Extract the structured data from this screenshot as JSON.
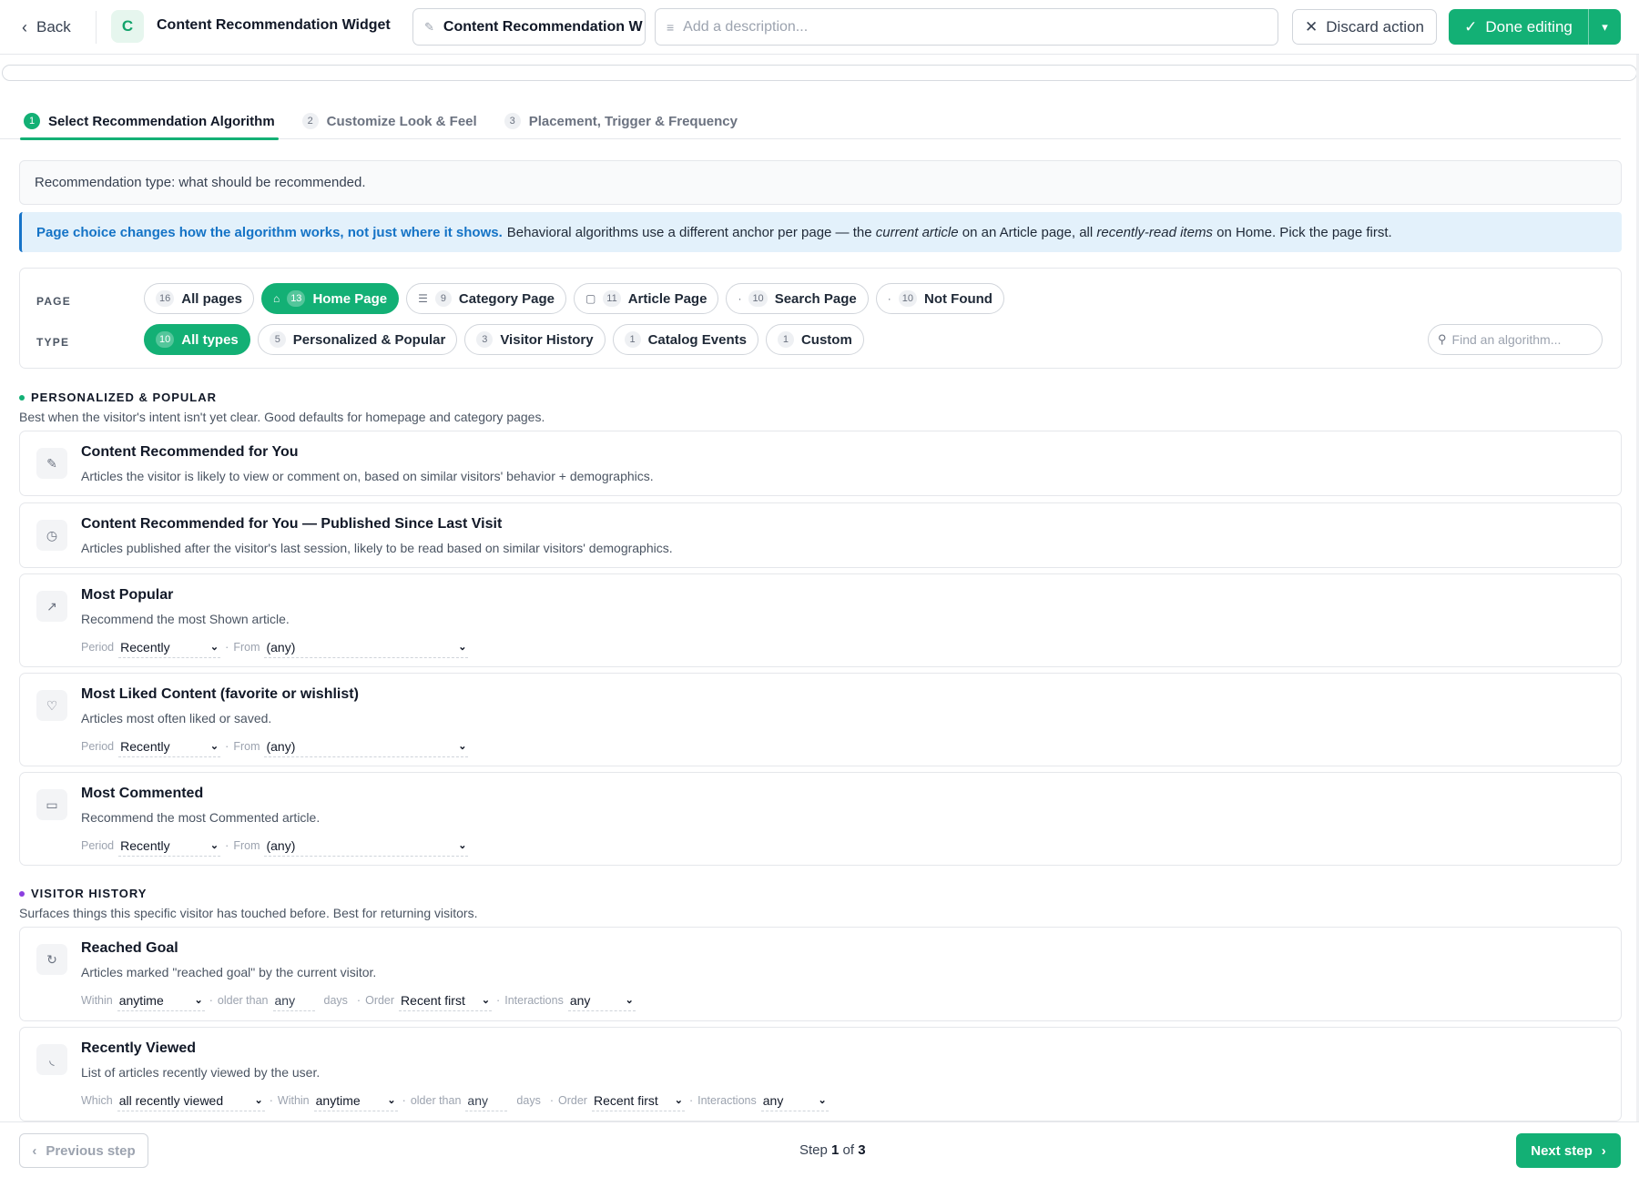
{
  "header": {
    "back_label": "Back",
    "avatar_letter": "C",
    "widget_title": "Content Recommendation Widget",
    "name_value": "Content Recommendation W",
    "description_placeholder": "Add a description...",
    "discard_label": "Discard action",
    "done_label": "Done editing"
  },
  "tabs": [
    {
      "num": "1",
      "label": "Select Recommendation Algorithm",
      "active": true
    },
    {
      "num": "2",
      "label": "Customize Look & Feel",
      "active": false
    },
    {
      "num": "3",
      "label": "Placement, Trigger & Frequency",
      "active": false
    }
  ],
  "rec_type_note": "Recommendation type: what should be recommended.",
  "banner": {
    "strong": "Page choice changes how the algorithm works, not just where it shows.",
    "p1": "Behavioral algorithms use a different anchor per page — the",
    "em1": "current article",
    "p2": "on an Article page, all",
    "em2": "recently-read items",
    "p3": "on Home. Pick the page first."
  },
  "filters": {
    "page_label": "PAGE",
    "type_label": "TYPE",
    "pages": [
      {
        "count": "16",
        "label": "All pages",
        "icon": "",
        "active": false
      },
      {
        "count": "13",
        "label": "Home Page",
        "icon": "⌂",
        "active": true
      },
      {
        "count": "9",
        "label": "Category Page",
        "icon": "☰",
        "active": false
      },
      {
        "count": "11",
        "label": "Article Page",
        "icon": "▢",
        "active": false
      },
      {
        "count": "10",
        "label": "Search Page",
        "icon": "·",
        "active": false
      },
      {
        "count": "10",
        "label": "Not Found",
        "icon": "·",
        "active": false
      }
    ],
    "types": [
      {
        "count": "10",
        "label": "All types",
        "active": true
      },
      {
        "count": "5",
        "label": "Personalized & Popular",
        "active": false
      },
      {
        "count": "3",
        "label": "Visitor History",
        "active": false
      },
      {
        "count": "1",
        "label": "Catalog Events",
        "active": false
      },
      {
        "count": "1",
        "label": "Custom",
        "active": false
      }
    ],
    "search_placeholder": "Find an algorithm..."
  },
  "sections": {
    "personalized": {
      "title": "PERSONALIZED & POPULAR",
      "desc": "Best when the visitor's intent isn't yet clear. Good defaults for homepage and category pages.",
      "dot_color": "#13b075",
      "cards": [
        {
          "title": "Content Recommended for You",
          "desc": "Articles the visitor is likely to view or comment on, based on similar visitors' behavior + demographics.",
          "icon": "pen-icon"
        },
        {
          "title": "Content Recommended for You — Published Since Last Visit",
          "desc": "Articles published after the visitor's last session, likely to be read based on similar visitors' demographics.",
          "icon": "clock-icon"
        },
        {
          "title": "Most Popular",
          "desc": "Recommend the most Shown article.",
          "icon": "trend-icon"
        },
        {
          "title": "Most Liked Content (favorite or wishlist)",
          "desc": "Articles most often liked or saved.",
          "icon": "heart-icon"
        },
        {
          "title": "Most Commented",
          "desc": "Recommend the most Commented article.",
          "icon": "comment-icon"
        }
      ]
    },
    "history": {
      "title": "VISITOR HISTORY",
      "desc": "Surfaces things this specific visitor has touched before. Best for returning visitors.",
      "dot_color": "#8b3fe0",
      "cards": [
        {
          "title": "Reached Goal",
          "desc": "Articles marked \"reached goal\" by the current visitor.",
          "icon": "refresh-icon"
        },
        {
          "title": "Recently Viewed",
          "desc": "List of articles recently viewed by the user.",
          "icon": "recent-icon"
        }
      ]
    }
  },
  "options": {
    "period_label": "Period",
    "from_label": "From",
    "within_label": "Within",
    "older_than_label": "older than",
    "days_label": "days",
    "order_label": "Order",
    "interactions_label": "Interactions",
    "which_label": "Which",
    "sep": "·",
    "period_value": "Recently",
    "from_value": "(any)",
    "within_value": "anytime",
    "older_value": "any",
    "order_value": "Recent first",
    "interactions_value": "any",
    "which_value": "all recently viewed"
  },
  "footer": {
    "prev_label": "Previous step",
    "step_word": "Step",
    "step_current": "1",
    "step_of": "of",
    "step_total": "3",
    "next_label": "Next step"
  },
  "colors": {
    "accent": "#13b075",
    "info_blue": "#1473c6",
    "history_dot": "#8b3fe0"
  }
}
